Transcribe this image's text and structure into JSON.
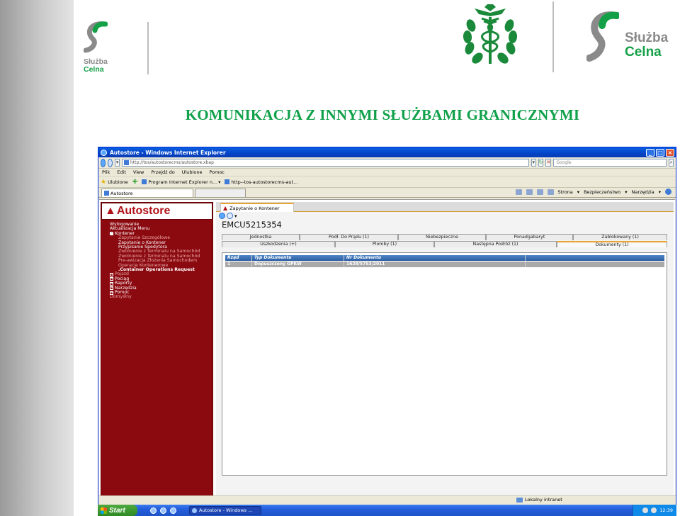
{
  "slide": {
    "title": "KOMUNIKACJA Z INNYMI SŁUŻBAMI GRANICZNYMI",
    "left_logo": {
      "line1": "Służba",
      "line2": "Celna"
    },
    "right_logo": {
      "line1": "Służba",
      "line2": "Celna"
    },
    "colors": {
      "title": "#10a14a",
      "emblem": "#1a8a3a",
      "brand_green": "#14a046",
      "brand_grey": "#8a8a8a",
      "autostore_red": "#8b0a10"
    }
  },
  "ie": {
    "window_title": "Autostore - Windows Internet Explorer",
    "address": "http://tos/autostorecms/autostore.xbap",
    "search_placeholder": "Google",
    "menu": [
      "Plik",
      "Edit",
      "View",
      "Przejdź do",
      "Ulubione",
      "Pomoc"
    ],
    "favorites_label": "Ulubione",
    "favorites": [
      "Program Internet Explorer n...",
      "http--tos-autostorecms-aut..."
    ],
    "tab_label": "Autostore",
    "tools": [
      "Strona",
      "Bezpieczeństwo",
      "Narzędzia"
    ],
    "status_zone": "Lokalny intranet"
  },
  "app": {
    "logo": "Autostore",
    "tree": [
      {
        "label": "Wylogowanie",
        "level": 0,
        "style": "normal",
        "icon": ""
      },
      {
        "label": "Aktualizacja Menu",
        "level": 0,
        "style": "normal",
        "icon": ""
      },
      {
        "label": "Kontener",
        "level": 0,
        "style": "normal",
        "icon": "minus"
      },
      {
        "label": "Zapytanie Szczegółowe",
        "level": 1,
        "style": "dim",
        "icon": ""
      },
      {
        "label": "Zapytanie o Kontener",
        "level": 1,
        "style": "normal",
        "icon": ""
      },
      {
        "label": "Przypisanie Spedytora",
        "level": 1,
        "style": "normal",
        "icon": ""
      },
      {
        "label": "Zwolnienie z Terminalu na Samochód",
        "level": 1,
        "style": "dim",
        "icon": ""
      },
      {
        "label": "Zwolnienie z Terminalu na Samochód",
        "level": 1,
        "style": "dim",
        "icon": ""
      },
      {
        "label": "Pre-awizacja Złożenia Samochodem",
        "level": 1,
        "style": "dim",
        "icon": ""
      },
      {
        "label": "Operacje Kontenerowe",
        "level": 1,
        "style": "dim",
        "icon": ""
      },
      {
        "label": ".Container Operations Request",
        "level": 1,
        "style": "active",
        "icon": ""
      },
      {
        "label": "Pojazd",
        "level": 0,
        "style": "dim",
        "icon": "plus"
      },
      {
        "label": "Pociąg",
        "level": 0,
        "style": "normal",
        "icon": "plus"
      },
      {
        "label": "Raporty",
        "level": 0,
        "style": "normal",
        "icon": "plus"
      },
      {
        "label": "Narzędzia",
        "level": 0,
        "style": "normal",
        "icon": "plus"
      },
      {
        "label": "Pomoc",
        "level": 0,
        "style": "normal",
        "icon": "plus"
      },
      {
        "label": "Domyślny",
        "level": 0,
        "style": "dim",
        "icon": ""
      }
    ],
    "doc_tab": "Zapytanie o Kontener",
    "container_id": "EMCU5215354",
    "tabs_row1": [
      "Jednostka",
      "Podł. Do Prądu (1)",
      "Niebezpieczne",
      "Ponadgabaryt",
      "Zablokowany (1)"
    ],
    "tabs_row2": [
      "Uszkodzenia (+)",
      "Plomby (1)",
      "Następna Podróż (1)",
      "Dokumenty (1)"
    ],
    "selected_tab": "Dokumenty (1)",
    "grid": {
      "columns": [
        "Rząd",
        "Typ Dokumentu",
        "Nr Dokumentu"
      ],
      "rows": [
        [
          "1",
          "Dopuszczony GPKW",
          "1628/5753/2011"
        ]
      ]
    }
  },
  "taskbar": {
    "start": "Start",
    "task": "Autostore - Windows ...",
    "clock": "12:39"
  }
}
